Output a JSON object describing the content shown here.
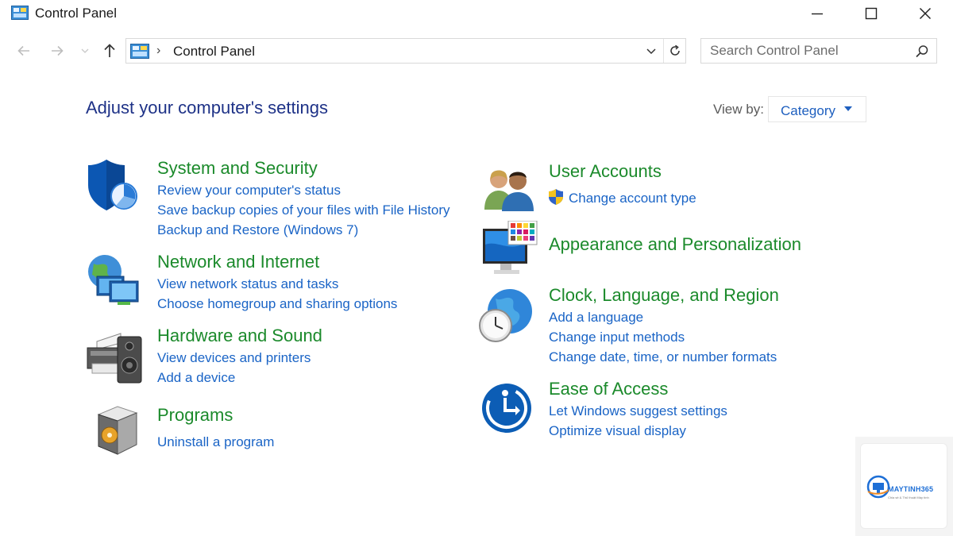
{
  "window": {
    "title": "Control Panel"
  },
  "address": {
    "separator": "›",
    "path": "Control Panel"
  },
  "search": {
    "placeholder": "Search Control Panel"
  },
  "main": {
    "heading": "Adjust your computer's settings",
    "view_by_label": "View by:",
    "view_by_value": "Category"
  },
  "categories": [
    {
      "title": "System and Security",
      "icon": "shield-icon",
      "links": [
        "Review your computer's status",
        "Save backup copies of your files with File History",
        "Backup and Restore (Windows 7)"
      ]
    },
    {
      "title": "Network and Internet",
      "icon": "network-globe-icon",
      "links": [
        "View network status and tasks",
        "Choose homegroup and sharing options"
      ]
    },
    {
      "title": "Hardware and Sound",
      "icon": "printer-speaker-icon",
      "links": [
        "View devices and printers",
        "Add a device"
      ]
    },
    {
      "title": "Programs",
      "icon": "programs-box-icon",
      "links": [
        "Uninstall a program"
      ]
    },
    {
      "title": "User Accounts",
      "icon": "users-icon",
      "links": [
        "Change account type"
      ]
    },
    {
      "title": "Appearance and Personalization",
      "icon": "monitor-palette-icon",
      "links": []
    },
    {
      "title": "Clock, Language, and Region",
      "icon": "clock-globe-icon",
      "links": [
        "Add a language",
        "Change input methods",
        "Change date, time, or number formats"
      ]
    },
    {
      "title": "Ease of Access",
      "icon": "ease-of-access-icon",
      "links": [
        "Let Windows suggest settings",
        "Optimize visual display"
      ]
    }
  ],
  "watermark": {
    "brand": "MAYTINH365",
    "tagline": "Chia sẻ & Thủ thuật Máy tính"
  },
  "colors": {
    "heading": "#1e3287",
    "category_title": "#1b8a2b",
    "link": "#1a64c6",
    "shield_blue": "#0c57b3",
    "accent_blue": "#1e6fd6"
  }
}
